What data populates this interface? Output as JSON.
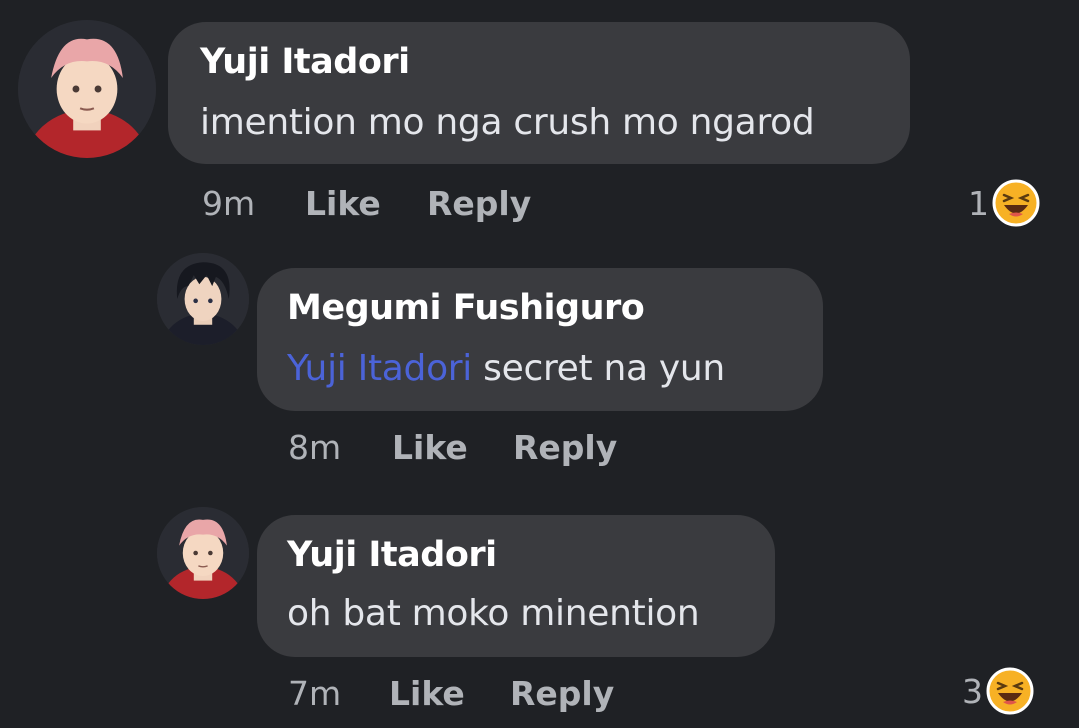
{
  "comments": [
    {
      "author": "Yuji Itadori",
      "text": "imention mo nga crush mo ngarod",
      "time": "9m",
      "like_label": "Like",
      "reply_label": "Reply",
      "reaction_count": "1",
      "reaction_icon": "laughing-emoji-icon"
    },
    {
      "author": "Megumi Fushiguro",
      "mention": "Yuji Itadori",
      "text": " secret na yun",
      "time": "8m",
      "like_label": "Like",
      "reply_label": "Reply"
    },
    {
      "author": "Yuji Itadori",
      "text": "oh bat moko minention",
      "time": "7m",
      "like_label": "Like",
      "reply_label": "Reply",
      "reaction_count": "3",
      "reaction_icon": "laughing-emoji-icon"
    }
  ],
  "colors": {
    "background": "#1f2125",
    "bubble": "#3a3b3f",
    "mention": "#4b63d8",
    "meta": "#b0b3b8",
    "emoji": "#f7b125"
  }
}
